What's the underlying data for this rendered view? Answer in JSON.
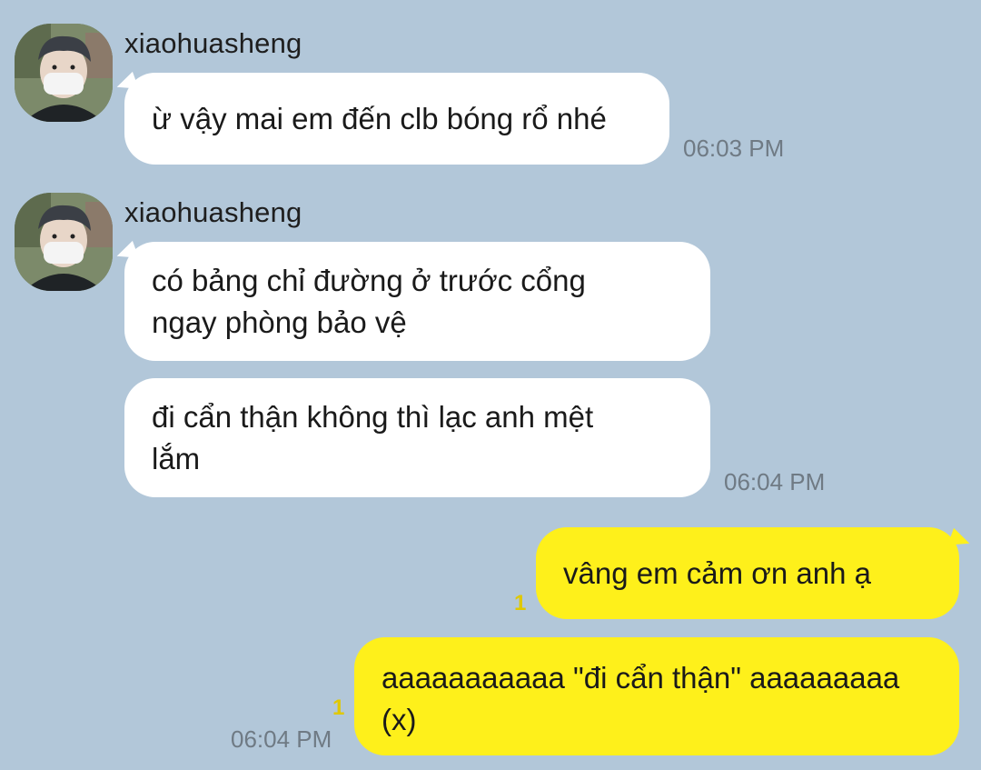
{
  "messages": {
    "m1": {
      "sender": "xiaohuasheng",
      "text": "ừ vậy mai em đến clb bóng rổ nhé",
      "time": "06:03 PM"
    },
    "m2": {
      "sender": "xiaohuasheng",
      "text": "có bảng chỉ đường ở trước cổng\nngay phòng bảo vệ"
    },
    "m3": {
      "text": "đi cẩn thận không thì lạc anh mệt\nlắm",
      "time": "06:04 PM"
    },
    "m4": {
      "text": "vâng em cảm ơn anh ạ",
      "unread": "1"
    },
    "m5": {
      "text": "aaaaaaaaaaa \"đi cẩn thận\" aaaaaaaaa\n(x)",
      "unread": "1",
      "time": "06:04 PM"
    }
  },
  "colors": {
    "background": "#b2c7d9",
    "incoming_bubble": "#ffffff",
    "outgoing_bubble": "#fef01b",
    "unread_count": "#e0c800",
    "timestamp": "#6f7a84"
  },
  "icons": {
    "avatar": "profile-photo-masked-person",
    "emoji": "kissing-cat-emoji"
  }
}
